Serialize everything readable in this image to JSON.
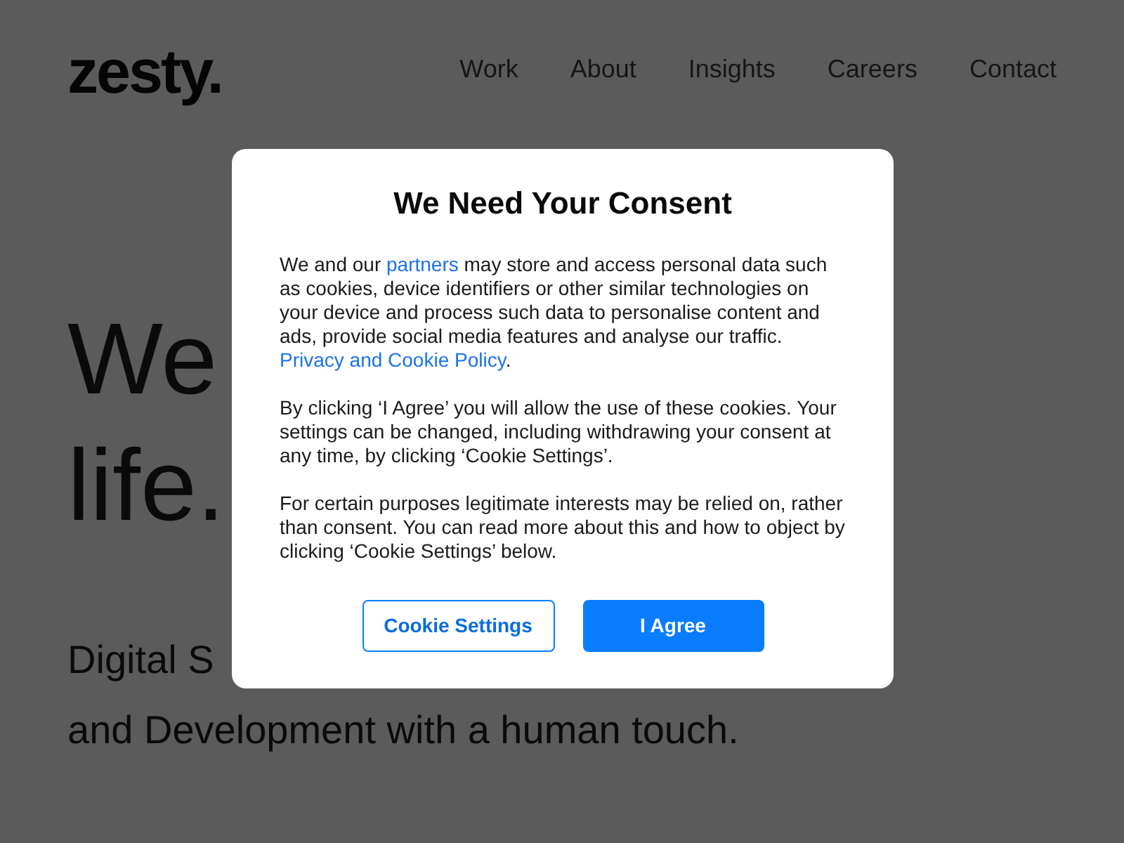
{
  "header": {
    "logo": "zesty.",
    "nav": [
      "Work",
      "About",
      "Insights",
      "Careers",
      "Contact"
    ]
  },
  "hero": {
    "headline_lines": [
      "We",
      "life."
    ],
    "subtitle_lines": [
      "Digital S",
      "and Development with a human touch."
    ]
  },
  "consent_dialog": {
    "title": "We Need Your Consent",
    "paragraphs": [
      [
        {
          "text": "We and our "
        },
        {
          "text": "partners",
          "kind": "link"
        },
        {
          "text": " may store and access personal data such as cookies, device identifiers or other similar technologies on your device and process such data to personalise content and ads, provide social media features and analyse our traffic. "
        },
        {
          "text": "Privacy and Cookie Policy",
          "kind": "link"
        },
        {
          "text": "."
        }
      ],
      [
        {
          "text": "By clicking ‘I Agree’ you will allow the use of these cookies. Your settings can be changed, including withdrawing your consent at any time, by clicking ‘Cookie Settings’."
        }
      ],
      [
        {
          "text": "For certain purposes legitimate interests may be relied on, rather than consent. You can read more about this and how to object by clicking ‘Cookie Settings’ below."
        }
      ]
    ],
    "buttons": [
      {
        "label": "Cookie Settings",
        "kind": "outline"
      },
      {
        "label": "I Agree",
        "kind": "primary"
      }
    ]
  }
}
